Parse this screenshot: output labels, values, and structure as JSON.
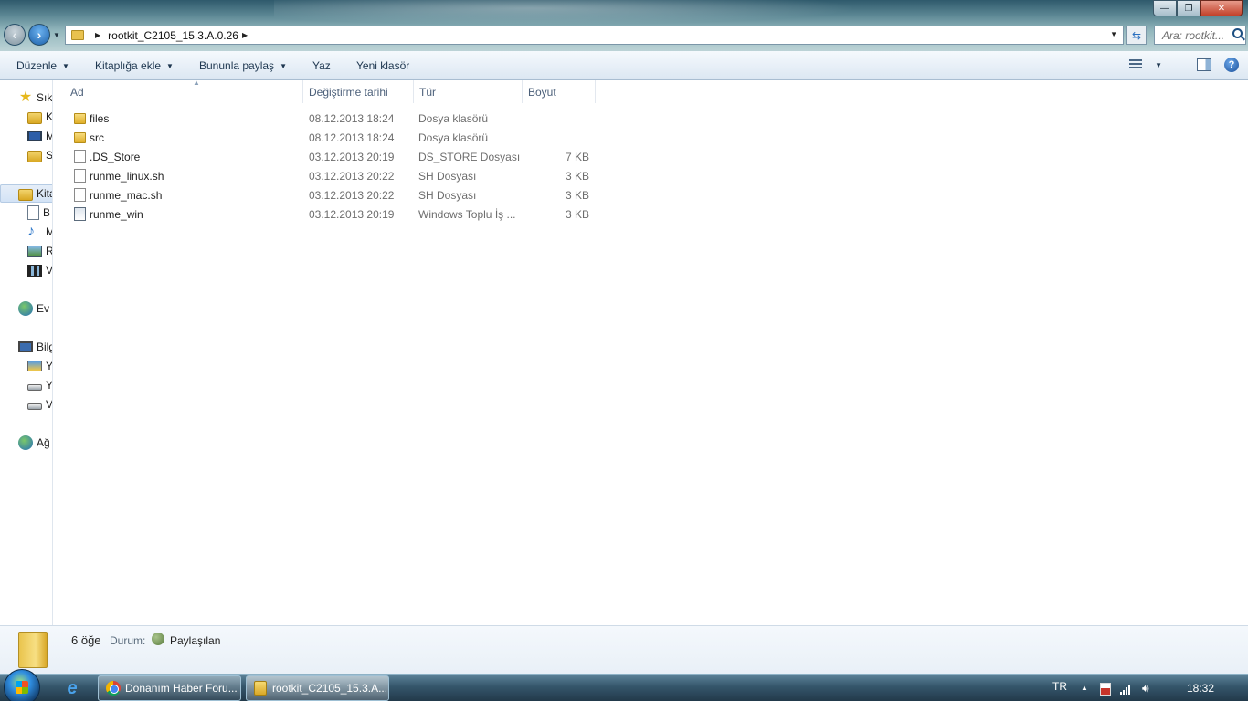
{
  "window": {
    "minimize": "—",
    "maximize": "❐",
    "close": "✕"
  },
  "address": {
    "crumb": "rootkit_C2105_15.3.A.0.26",
    "search_placeholder": "Ara: rootkit..."
  },
  "toolbar": {
    "organize": "Düzenle",
    "include_library": "Kitaplığa ekle",
    "share_with": "Bununla paylaş",
    "burn": "Yaz",
    "new_folder": "Yeni klasör"
  },
  "nav": {
    "favorites": "Sık",
    "fav_1": "K",
    "fav_2": "M",
    "fav_3": "S",
    "libraries": "Kita",
    "lib_1": "B",
    "lib_2": "M",
    "lib_3": "R",
    "lib_4": "V",
    "homegroup": "Ev",
    "computer": "Bilg",
    "drive_1": "Y",
    "drive_2": "Y",
    "drive_3": "V",
    "network": "Ağ"
  },
  "columns": {
    "name": "Ad",
    "date": "Değiştirme tarihi",
    "type": "Tür",
    "size": "Boyut"
  },
  "files": [
    {
      "name": "files",
      "date": "08.12.2013 18:24",
      "type": "Dosya klasörü",
      "size": "",
      "icon": "folder-icon"
    },
    {
      "name": "src",
      "date": "08.12.2013 18:24",
      "type": "Dosya klasörü",
      "size": "",
      "icon": "folder-icon"
    },
    {
      "name": ".DS_Store",
      "date": "03.12.2013 20:19",
      "type": "DS_STORE Dosyası",
      "size": "7 KB",
      "icon": "file-icon"
    },
    {
      "name": "runme_linux.sh",
      "date": "03.12.2013 20:22",
      "type": "SH Dosyası",
      "size": "3 KB",
      "icon": "file-icon"
    },
    {
      "name": "runme_mac.sh",
      "date": "03.12.2013 20:22",
      "type": "SH Dosyası",
      "size": "3 KB",
      "icon": "file-icon"
    },
    {
      "name": "runme_win",
      "date": "03.12.2013 20:19",
      "type": "Windows Toplu İş ...",
      "size": "3 KB",
      "icon": "batch-file-icon"
    }
  ],
  "details": {
    "count": "6 öğe",
    "status_label": "Durum:",
    "status_value": "Paylaşılan"
  },
  "taskbar": {
    "task_1": "Donanım Haber Foru...",
    "task_2": "rootkit_C2105_15.3.A...",
    "lang": "TR",
    "clock": "18:32"
  }
}
